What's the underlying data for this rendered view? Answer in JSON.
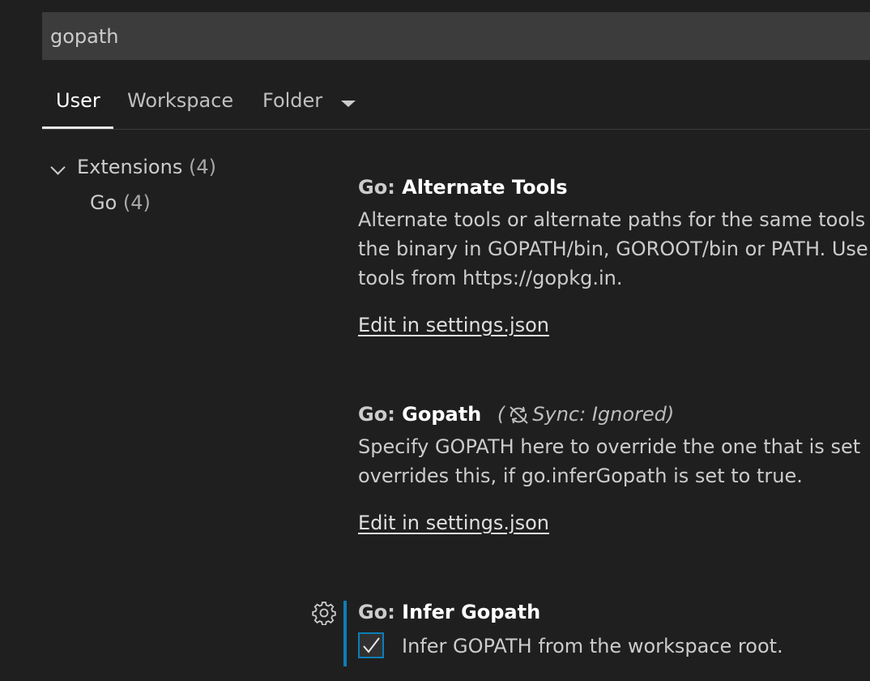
{
  "search": {
    "value": "gopath"
  },
  "tabs": [
    {
      "label": "User",
      "active": true
    },
    {
      "label": "Workspace",
      "active": false
    },
    {
      "label": "Folder",
      "active": false
    }
  ],
  "tree": {
    "extensions_label": "Extensions",
    "extensions_count": "(4)",
    "go_label": "Go",
    "go_count": "(4)"
  },
  "settings": [
    {
      "category": "Go: ",
      "name": "Alternate Tools",
      "description_lines": [
        "Alternate tools or alternate paths for the same tools",
        "the binary in GOPATH/bin, GOROOT/bin or PATH. Use",
        "tools from https://gopkg.in."
      ],
      "edit_link": "Edit in settings.json"
    },
    {
      "category": "Go: ",
      "name": "Gopath",
      "sync_open": "(",
      "sync_text": "Sync: Ignored)",
      "description_lines": [
        "Specify GOPATH here to override the one that is set",
        "overrides this, if go.inferGopath is set to true."
      ],
      "edit_link": "Edit in settings.json"
    },
    {
      "category": "Go: ",
      "name": "Infer Gopath",
      "checkbox_label": "Infer GOPATH from the workspace root.",
      "checked": true
    }
  ],
  "colors": {
    "background": "#1f1f1f",
    "input_background": "#3c3c3c",
    "accent": "#0c7eb8"
  },
  "icons": {
    "tab_dropdown": "chevron-down-icon",
    "tree_chevron": "chevron-down-icon",
    "sync": "sync-ignored-icon",
    "gear": "gear-icon",
    "check": "check-icon"
  }
}
